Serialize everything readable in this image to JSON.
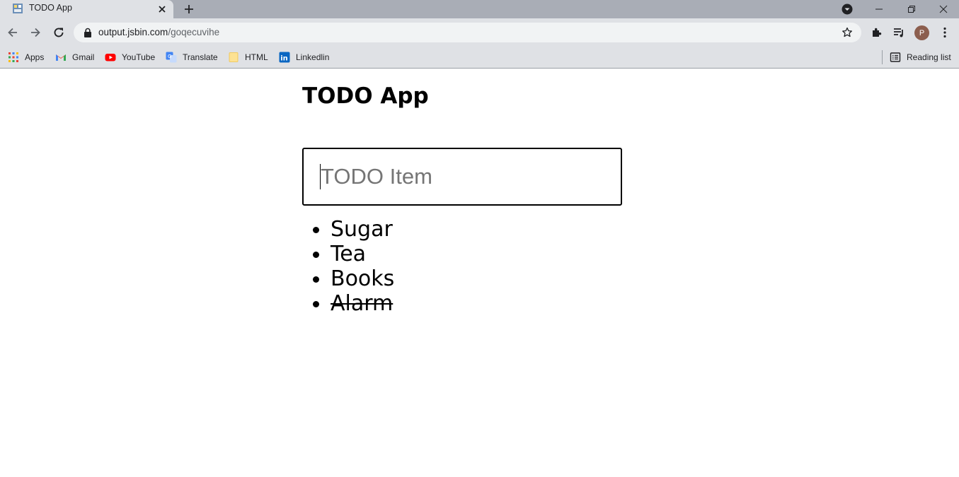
{
  "browser": {
    "tab": {
      "title": "TODO App"
    },
    "address": {
      "host": "output.jsbin.com",
      "path": "/goqecuvihe"
    },
    "bookmarks": [
      {
        "label": "Apps",
        "icon": "apps-grid-icon"
      },
      {
        "label": "Gmail",
        "icon": "gmail-icon"
      },
      {
        "label": "YouTube",
        "icon": "youtube-icon"
      },
      {
        "label": "Translate",
        "icon": "translate-icon"
      },
      {
        "label": "HTML",
        "icon": "folder-icon"
      },
      {
        "label": "Linkedlin",
        "icon": "linkedin-icon"
      }
    ],
    "reading_list": "Reading list",
    "profile_initial": "P",
    "colors": {
      "tabstrip": "#a9adb6",
      "toolbar": "#dfe1e5",
      "avatar": "#8c5e4e"
    }
  },
  "app": {
    "title": "TODO App",
    "input": {
      "placeholder": "TODO Item",
      "value": ""
    },
    "items": [
      {
        "text": "Sugar",
        "done": false
      },
      {
        "text": "Tea",
        "done": false
      },
      {
        "text": "Books",
        "done": false
      },
      {
        "text": "Alarm",
        "done": true
      }
    ]
  }
}
